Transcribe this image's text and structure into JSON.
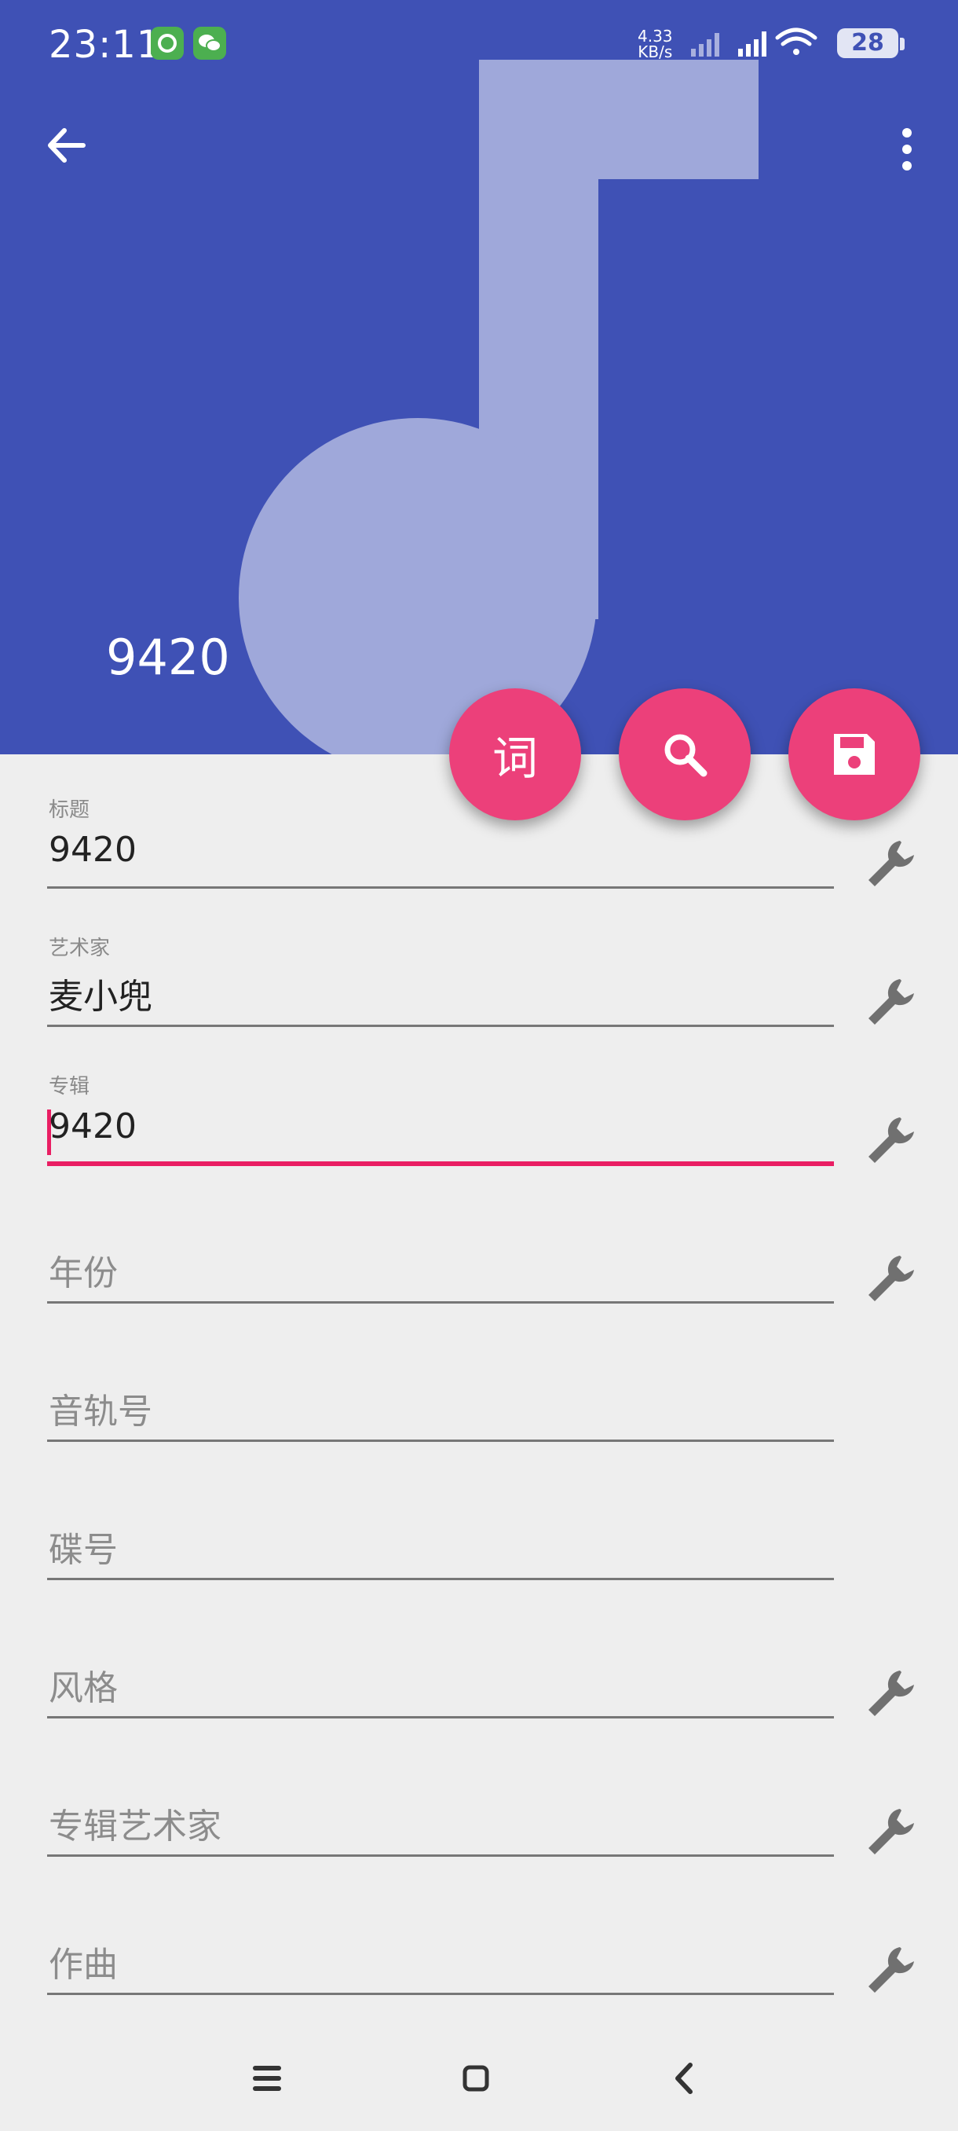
{
  "status_bar": {
    "time": "23:11",
    "net_speed_value": "4.33",
    "net_speed_unit": "KB/s",
    "battery": "28",
    "icons": [
      "app-green-icon",
      "wechat-icon",
      "signal-1-icon",
      "signal-2-icon",
      "wifi-icon",
      "battery-icon"
    ]
  },
  "toolbar": {
    "back_icon": "arrow-back-icon",
    "menu_icon": "more-vert-icon"
  },
  "cover": {
    "title": "9420",
    "background_color": "#3f51b5",
    "art_icon": "music-note-icon"
  },
  "fabs": [
    {
      "name": "lyrics",
      "label": "词"
    },
    {
      "name": "search",
      "icon": "search-icon"
    },
    {
      "name": "save",
      "icon": "save-icon"
    }
  ],
  "fields": [
    {
      "label": "标题",
      "value": "9420",
      "placeholder": ""
    },
    {
      "label": "艺术家",
      "value": "麦小兜",
      "placeholder": ""
    },
    {
      "label": "专辑",
      "value": "9420",
      "placeholder": "",
      "focused": true
    },
    {
      "label": "",
      "value": "",
      "placeholder": "年份"
    },
    {
      "label": "",
      "value": "",
      "placeholder": "音轨号"
    },
    {
      "label": "",
      "value": "",
      "placeholder": "碟号"
    },
    {
      "label": "",
      "value": "",
      "placeholder": "风格"
    },
    {
      "label": "",
      "value": "",
      "placeholder": "专辑艺术家"
    },
    {
      "label": "",
      "value": "",
      "placeholder": "作曲"
    }
  ],
  "colors": {
    "primary": "#3f51b5",
    "accent": "#ec407a",
    "background": "#eeeeee"
  },
  "nav_bar": {
    "icons": [
      "menu-icon",
      "home-icon",
      "back-icon"
    ]
  }
}
